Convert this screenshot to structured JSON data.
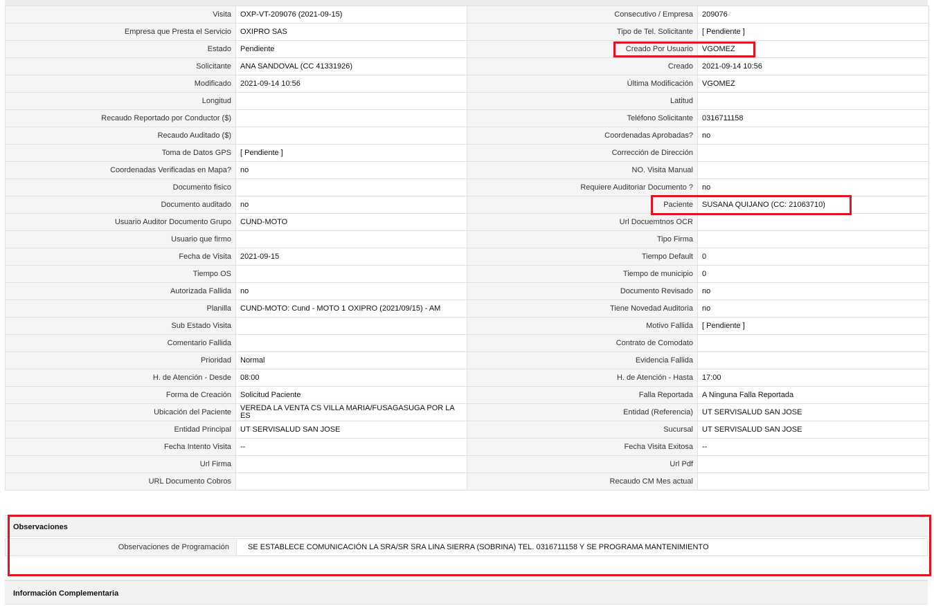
{
  "visit": {
    "visita": {
      "label": "Visita",
      "value": "OXP-VT-209076 (2021-09-15)"
    },
    "consecutivo": {
      "label": "Consecutivo / Empresa",
      "value": "209076"
    },
    "empresa": {
      "label": "Empresa que Presta el Servicio",
      "value": "OXIPRO SAS"
    },
    "tipo_tel": {
      "label": "Tipo de Tel. Solicitante",
      "value": "[ Pendiente ]"
    },
    "estado": {
      "label": "Estado",
      "value": "Pendiente"
    },
    "creado_por": {
      "label": "Creado Por Usuario",
      "value": "VGOMEZ"
    },
    "solicitante": {
      "label": "Solicitante",
      "value": "ANA SANDOVAL (CC 41331926)"
    },
    "creado": {
      "label": "Creado",
      "value": "2021-09-14 10:56"
    },
    "modificado": {
      "label": "Modificado",
      "value": "2021-09-14 10:56"
    },
    "ultima_mod": {
      "label": "Última Modificación",
      "value": "VGOMEZ"
    },
    "longitud": {
      "label": "Longitud",
      "value": ""
    },
    "latitud": {
      "label": "Latitud",
      "value": ""
    },
    "recaudo_conductor": {
      "label": "Recaudo Reportado por Conductor ($)",
      "value": ""
    },
    "telefono": {
      "label": "Teléfono Solicitante",
      "value": "0316711158"
    },
    "recaudo_auditado": {
      "label": "Recaudo Auditado ($)",
      "value": ""
    },
    "coord_aprobadas": {
      "label": "Coordenadas Aprobadas?",
      "value": "no"
    },
    "toma_gps": {
      "label": "Toma de Datos GPS",
      "value": "[ Pendiente ]"
    },
    "correccion_dir": {
      "label": "Corrección de Dirección",
      "value": ""
    },
    "coord_verificadas": {
      "label": "Coordenadas Verificadas en Mapa?",
      "value": "no"
    },
    "visita_manual": {
      "label": "NO. Visita Manual",
      "value": ""
    },
    "doc_fisico": {
      "label": "Documento fisico",
      "value": ""
    },
    "req_auditoriar": {
      "label": "Requiere Auditoriar Documento ?",
      "value": "no"
    },
    "doc_auditado": {
      "label": "Documento auditado",
      "value": "no"
    },
    "paciente": {
      "label": "Paciente",
      "value": "SUSANA QUIJANO (CC: 21063710)"
    },
    "usuario_auditor": {
      "label": "Usuario Auditor Documento Grupo",
      "value": "CUND-MOTO"
    },
    "url_ocr": {
      "label": "Url Docuemtnos OCR",
      "value": ""
    },
    "usuario_firmo": {
      "label": "Usuario que firmo",
      "value": ""
    },
    "tipo_firma": {
      "label": "Tipo Firma",
      "value": ""
    },
    "fecha_visita": {
      "label": "Fecha de Visita",
      "value": "2021-09-15"
    },
    "tiempo_default": {
      "label": "Tiempo Default",
      "value": "0"
    },
    "tiempo_os": {
      "label": "Tiempo OS",
      "value": ""
    },
    "tiempo_municipio": {
      "label": "Tiempo de municipio",
      "value": "0"
    },
    "autorizada_fallida": {
      "label": "Autorizada Fallida",
      "value": "no"
    },
    "doc_revisado": {
      "label": "Documento Revisado",
      "value": "no"
    },
    "planilla": {
      "label": "Planilla",
      "value": "CUND-MOTO: Cund - MOTO 1 OXIPRO (2021/09/15) - AM"
    },
    "novedad_auditoria": {
      "label": "Tiene Novedad Auditoria",
      "value": "no"
    },
    "sub_estado": {
      "label": "Sub Estado Visita",
      "value": ""
    },
    "motivo_fallida": {
      "label": "Motivo Fallida",
      "value": "[ Pendiente ]"
    },
    "comentario_fallida": {
      "label": "Comentario Fallida",
      "value": ""
    },
    "contrato_comodato": {
      "label": "Contrato de Comodato",
      "value": ""
    },
    "prioridad": {
      "label": "Prioridad",
      "value": "Normal"
    },
    "evidencia_fallida": {
      "label": "Evidencia Fallida",
      "value": ""
    },
    "atencion_desde": {
      "label": "H. de Atención - Desde",
      "value": "08:00"
    },
    "atencion_hasta": {
      "label": "H. de Atención - Hasta",
      "value": "17:00"
    },
    "forma_creacion": {
      "label": "Forma de Creación",
      "value": "Solicitud Paciente"
    },
    "falla_reportada": {
      "label": "Falla Reportada",
      "value": "A Ninguna Falla Reportada"
    },
    "ubicacion": {
      "label": "Ubicación del Paciente",
      "value": "VEREDA LA VENTA CS VILLA MARIA/FUSAGASUGA POR LA ES"
    },
    "entidad_ref": {
      "label": "Entidad (Referencia)",
      "value": "UT SERVISALUD SAN JOSE"
    },
    "entidad_principal": {
      "label": "Entidad Principal",
      "value": "UT SERVISALUD SAN JOSE"
    },
    "sucursal": {
      "label": "Sucursal",
      "value": "UT SERVISALUD SAN JOSE"
    },
    "fecha_intento": {
      "label": "Fecha Intento Visita",
      "value": "--"
    },
    "fecha_exitosa": {
      "label": "Fecha Visita Exitosa",
      "value": "--"
    },
    "url_firma": {
      "label": "Url Firma",
      "value": ""
    },
    "url_pdf": {
      "label": "Url Pdf",
      "value": ""
    },
    "url_cobros": {
      "label": "URL Documento Cobros",
      "value": ""
    },
    "recaudo_cm": {
      "label": "Recaudo CM Mes actual",
      "value": ""
    }
  },
  "observaciones": {
    "title": "Observaciones",
    "label": "Observaciones de Programación",
    "value": "SE ESTABLECE COMUNICACIÓN LA SRA/SR SRA LINA SIERRA (SOBRINA) TEL. 0316711158 Y SE PROGRAMA MANTENIMIENTO"
  },
  "complementaria": {
    "title": "Información Complementaria"
  },
  "colors": {
    "highlight": "#e0141e",
    "label_bg": "#f5f5f5",
    "border": "#e0e0e0"
  }
}
